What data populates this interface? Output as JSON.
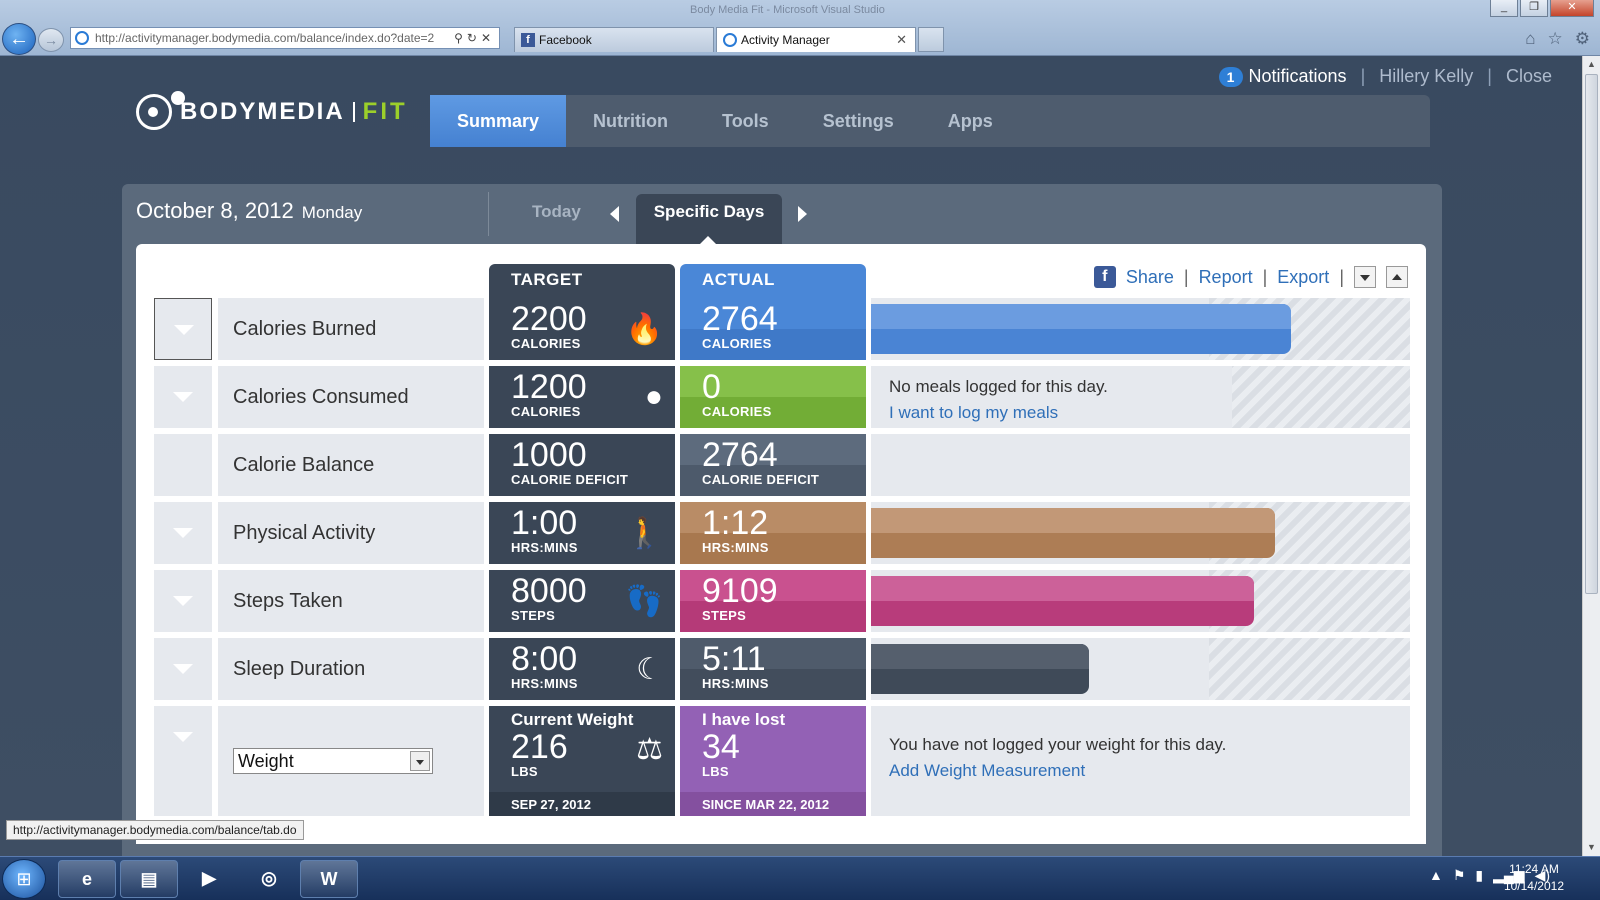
{
  "browser": {
    "window_title": "Body Media Fit - Microsoft Visual Studio",
    "url": "http://activitymanager.bodymedia.com/balance/index.do?date=2",
    "tabs": [
      {
        "label": "Facebook"
      },
      {
        "label": "Activity Manager"
      }
    ],
    "status_url": "http://activitymanager.bodymedia.com/balance/tab.do"
  },
  "header": {
    "notification_count": "1",
    "notifications_label": "Notifications",
    "separator": "|",
    "user_name": "Hillery Kelly",
    "close_label": "Close"
  },
  "logo": {
    "brand": "BODYMEDIA",
    "product": "FIT"
  },
  "nav": {
    "tabs": [
      {
        "label": "Summary",
        "active": true
      },
      {
        "label": "Nutrition"
      },
      {
        "label": "Tools"
      },
      {
        "label": "Settings"
      },
      {
        "label": "Apps"
      }
    ]
  },
  "datebar": {
    "date": "October 8, 2012",
    "weekday": "Monday",
    "today_label": "Today",
    "specific_days_label": "Specific Days"
  },
  "columns": {
    "target": "TARGET",
    "actual": "ACTUAL"
  },
  "actions": {
    "share": "Share",
    "report": "Report",
    "export": "Export",
    "separator": "|"
  },
  "rows": [
    {
      "label": "Calories Burned",
      "target_value": "2200",
      "target_unit": "CALORIES",
      "target_icon": "flame-icon",
      "actual_value": "2764",
      "actual_unit": "CALORIES",
      "actual_color": "#4a87d7",
      "actual_band": "#3f79c8",
      "bar_fraction": 0.78,
      "bar_color": "#4a84d4",
      "bar_top": "#6b9ce0",
      "target_fraction": 0.628
    },
    {
      "label": "Calories Consumed",
      "target_value": "1200",
      "target_unit": "CALORIES",
      "target_icon": "apple-icon",
      "actual_value": "0",
      "actual_unit": "CALORIES",
      "actual_color": "#86c04a",
      "actual_band": "#72ad36",
      "message": "No meals logged for this day.",
      "link": "I want to log my meals",
      "target_fraction": 0.67
    },
    {
      "label": "Calorie Balance",
      "target_value": "1000",
      "target_unit": "CALORIE DEFICIT",
      "actual_value": "2764",
      "actual_unit": "CALORIE DEFICIT",
      "actual_color": "#5d6b7d",
      "actual_band": "#4d5a6b"
    },
    {
      "label": "Physical Activity",
      "target_value": "1:00",
      "target_unit": "HRS:MINS",
      "target_icon": "walking-icon",
      "actual_value": "1:12",
      "actual_unit": "HRS:MINS",
      "actual_color": "#b98c66",
      "actual_band": "#a8784f",
      "bar_fraction": 0.75,
      "bar_color": "#ad7d55",
      "bar_top": "#c29877",
      "target_fraction": 0.628
    },
    {
      "label": "Steps Taken",
      "target_value": "8000",
      "target_unit": "STEPS",
      "target_icon": "footprints-icon",
      "actual_value": "9109",
      "actual_unit": "STEPS",
      "actual_color": "#c9518f",
      "actual_band": "#b53a78",
      "bar_fraction": 0.71,
      "bar_color": "#b83c7b",
      "bar_top": "#cc6199",
      "target_fraction": 0.628
    },
    {
      "label": "Sleep Duration",
      "target_value": "8:00",
      "target_unit": "HRS:MINS",
      "target_icon": "moon-icon",
      "actual_value": "5:11",
      "actual_unit": "HRS:MINS",
      "actual_color": "#4f5b6b",
      "actual_band": "#424d5c",
      "bar_fraction": 0.405,
      "bar_color": "#3f4a58",
      "bar_top": "#555f6d",
      "target_fraction": 0.628
    }
  ],
  "weight": {
    "select_value": "Weight",
    "target_title": "Current Weight",
    "target_value": "216",
    "target_unit": "LBS",
    "target_date": "SEP 27, 2012",
    "target_icon": "scale-icon",
    "actual_title": "I have lost",
    "actual_value": "34",
    "actual_unit": "LBS",
    "actual_date": "SINCE MAR 22, 2012",
    "actual_color": "#9361b5",
    "actual_band": "#84509f",
    "message": "You have not logged your weight for this day.",
    "link": "Add Weight Measurement"
  },
  "taskbar": {
    "time": "11:24 AM",
    "date": "10/14/2012"
  }
}
